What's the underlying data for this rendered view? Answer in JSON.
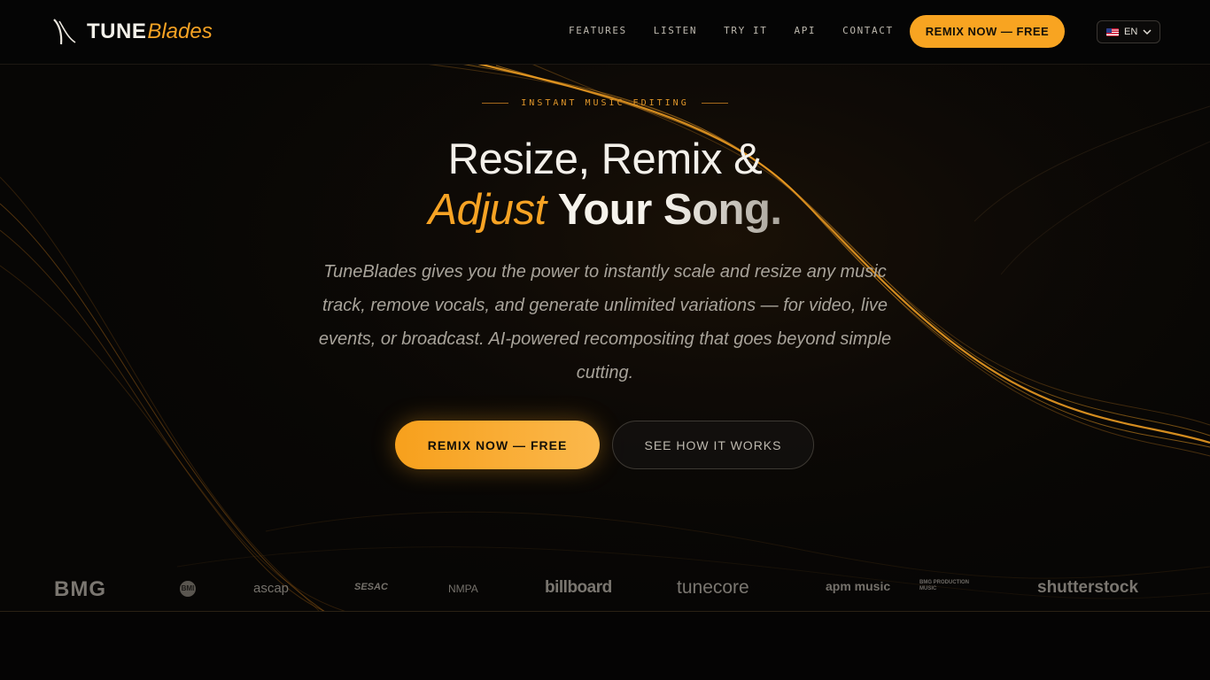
{
  "brand": {
    "name_bold": "TUNE",
    "name_italic": "Blades"
  },
  "nav": {
    "links": [
      "FEATURES",
      "LISTEN",
      "TRY IT",
      "API",
      "CONTACT"
    ],
    "cta": "REMIX NOW — FREE",
    "language": {
      "code": "EN",
      "flag": "us-flag-icon"
    }
  },
  "hero": {
    "eyebrow": "INSTANT MUSIC EDITING",
    "headline_line1": "Resize, Remix &",
    "headline_adjust": "Adjust",
    "headline_your": "Your",
    "headline_song": "Song.",
    "subtitle": "TuneBlades gives you the power to instantly scale and resize any music track, remove vocals, and generate unlimited variations — for video, live events, or broadcast. AI-powered recompositing that goes beyond simple cutting.",
    "primary_cta": "REMIX NOW — FREE",
    "secondary_cta": "SEE HOW IT WORKS"
  },
  "partners": [
    "BMG",
    "BMI",
    "ascap",
    "SESAC",
    "NMPA",
    "billboard",
    "tunecore",
    "apm music",
    "BMG PRODUCTION MUSIC",
    "shutterstock"
  ],
  "colors": {
    "accent": "#f7a324",
    "background": "#070605",
    "text": "#f3f0ea",
    "muted": "#a8a39a"
  }
}
